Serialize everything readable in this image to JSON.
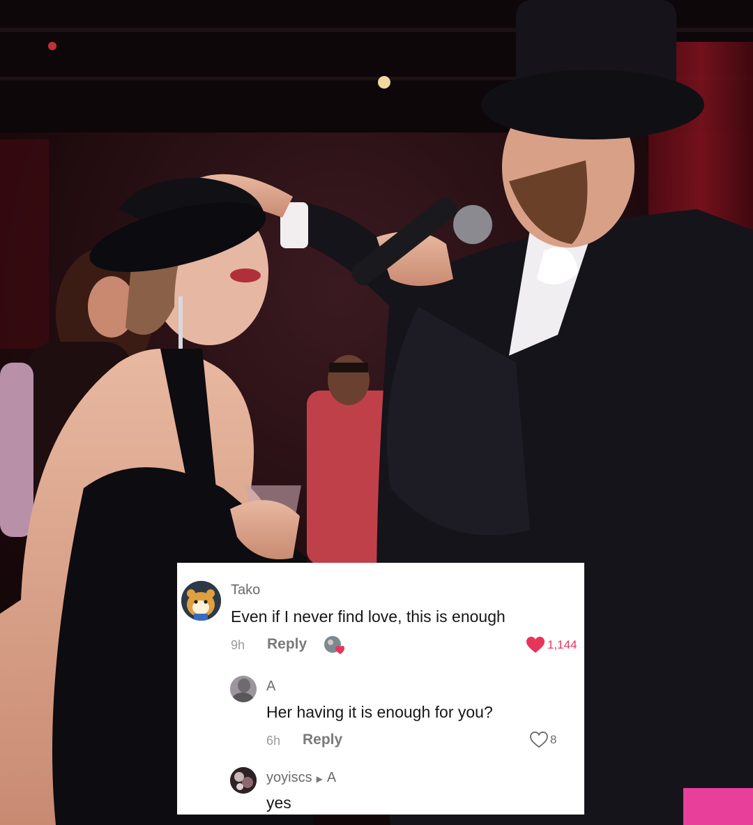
{
  "photo": {
    "description_icon": "party-photo"
  },
  "comments": [
    {
      "username": "Tako",
      "text": "Even if I never find love, this is enough",
      "time": "9h",
      "reply_label": "Reply",
      "likes": "1,144",
      "liked": true,
      "creator_liked": true
    },
    {
      "username": "A",
      "text": "Her having it is enough for you?",
      "time": "6h",
      "reply_label": "Reply",
      "likes": "8",
      "liked": false
    },
    {
      "username": "yoyiscs",
      "reply_to": "A",
      "text": "yes"
    }
  ],
  "colors": {
    "like_red": "#e8345a",
    "text_dark": "#161616",
    "text_muted": "#6b6b6b"
  }
}
